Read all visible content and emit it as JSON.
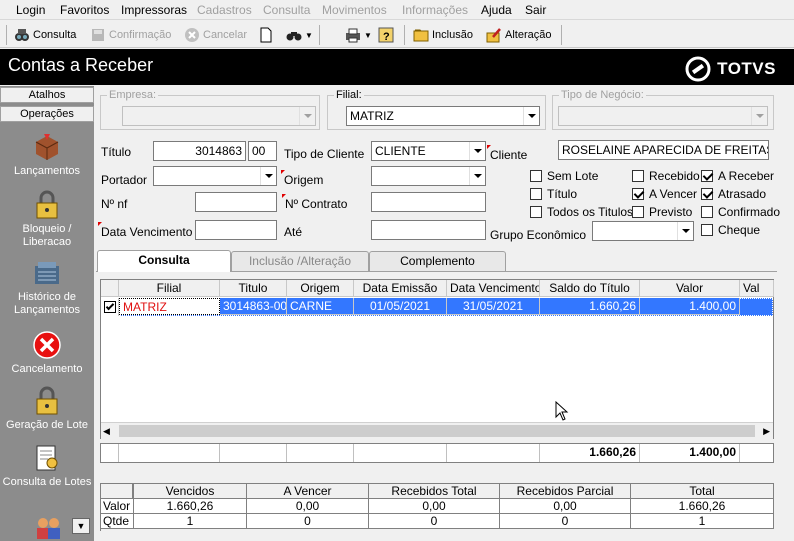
{
  "menu": [
    "Login",
    "Favoritos",
    "Impressoras",
    "Cadastros",
    "Consulta",
    "Movimentos",
    "Informações",
    "Ajuda",
    "Sair"
  ],
  "toolbar": {
    "consulta": "Consulta",
    "confirmacao": "Confirmação",
    "cancelar": "Cancelar",
    "inclusao": "Inclusão",
    "alteracao": "Alteração"
  },
  "title": "Contas a Receber",
  "logo_text": "TOTVS",
  "left_panel": {
    "tab_atalhos": "Atalhos",
    "tab_operacoes": "Operações",
    "items": [
      {
        "label": "Lançamentos"
      },
      {
        "label": "Bloqueio / Liberacao"
      },
      {
        "label": "Histórico de Lançamentos"
      },
      {
        "label": "Cancelamento"
      },
      {
        "label": "Geração de Lote"
      },
      {
        "label": "Consulta de Lotes"
      }
    ]
  },
  "filters": {
    "empresa_label": "Empresa:",
    "empresa_value": "",
    "filial_label": "Filial:",
    "filial_value": "MATRIZ",
    "tipo_negocio_label": "Tipo de Negócio:",
    "tipo_negocio_value": "",
    "titulo_label": "Título",
    "titulo_value": "3014863",
    "titulo_suffix": "00",
    "tipo_cliente_label": "Tipo de Cliente",
    "tipo_cliente_value": "CLIENTE",
    "cliente_label": "Cliente",
    "cliente_value": "ROSELAINE APARECIDA DE FREITAS",
    "portador_label": "Portador",
    "origem_label": "Origem",
    "nf_label": "Nº nf",
    "contrato_label": "Nº Contrato",
    "data_venc_label": "Data Vencimento",
    "ate_label": "Até",
    "grupo_label": "Grupo Econômico"
  },
  "checks": [
    {
      "label": "Sem Lote",
      "checked": false
    },
    {
      "label": "Título",
      "checked": false
    },
    {
      "label": "Todos os Titulos",
      "checked": false
    },
    {
      "label": "Recebido",
      "checked": false
    },
    {
      "label": "A Vencer",
      "checked": true
    },
    {
      "label": "Previsto",
      "checked": false
    },
    {
      "label": "A Receber",
      "checked": true
    },
    {
      "label": "Atrasado",
      "checked": true
    },
    {
      "label": "Confirmado",
      "checked": false
    },
    {
      "label": "Cheque",
      "checked": false
    }
  ],
  "tabs": [
    "Consulta",
    "Inclusão /Alteração",
    "Complemento"
  ],
  "grid": {
    "headers": [
      "Filial",
      "Titulo",
      "Origem",
      "Data Emissão",
      "Data Vencimento",
      "Saldo do Título",
      "Valor",
      "Val"
    ],
    "rows": [
      {
        "filial": "MATRIZ",
        "titulo": "3014863-00",
        "origem": "CARNE",
        "emissao": "01/05/2021",
        "vencimento": "31/05/2021",
        "saldo": "1.660,26",
        "valor": "1.400,00"
      }
    ],
    "total_saldo": "1.660,26",
    "total_valor": "1.400,00"
  },
  "summary": {
    "headers": [
      "Vencidos",
      "A Vencer",
      "Recebidos Total",
      "Recebidos Parcial",
      "Total"
    ],
    "row_valor_label": "Valor",
    "row_qtde_label": "Qtde",
    "valor": [
      "1.660,26",
      "0,00",
      "0,00",
      "0,00",
      "1.660,26"
    ],
    "qtde": [
      "1",
      "0",
      "0",
      "0",
      "1"
    ]
  },
  "colors": {
    "title_bg": "#000000",
    "selection": "#3377ff",
    "left_panel": "#8c8c8c",
    "error_red": "#e81010"
  }
}
